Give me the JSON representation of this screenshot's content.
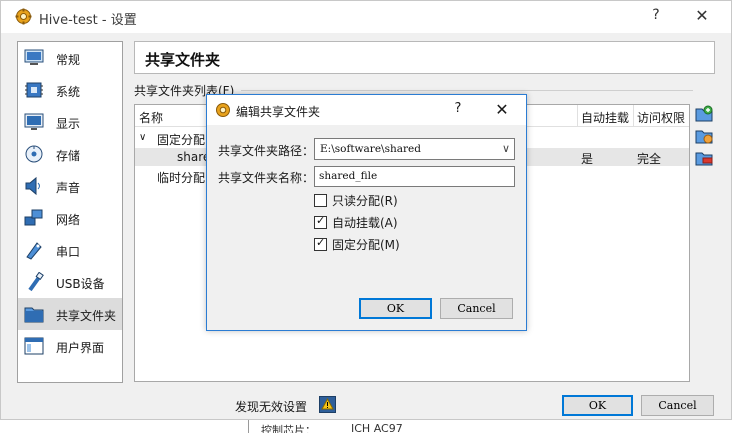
{
  "window": {
    "title": "Hive-test - 设置",
    "help": "?",
    "close": "✕"
  },
  "sidebar": {
    "items": [
      {
        "label": "常规",
        "icon": "monitor-icon"
      },
      {
        "label": "系统",
        "icon": "chip-icon"
      },
      {
        "label": "显示",
        "icon": "display-icon"
      },
      {
        "label": "存储",
        "icon": "storage-icon"
      },
      {
        "label": "声音",
        "icon": "speaker-icon"
      },
      {
        "label": "网络",
        "icon": "network-icon"
      },
      {
        "label": "串口",
        "icon": "serial-port-icon"
      },
      {
        "label": "USB设备",
        "icon": "usb-icon"
      },
      {
        "label": "共享文件夹",
        "icon": "folder-icon"
      },
      {
        "label": "用户界面",
        "icon": "ui-window-icon"
      }
    ],
    "active_index": 8
  },
  "page": {
    "title": "共享文件夹",
    "list_label": "共享文件夹列表(F)",
    "columns": {
      "name": "名称",
      "automount": "自动挂载",
      "access": "访问权限"
    },
    "tree": {
      "machine_folders": "固定分配",
      "shared_row": {
        "name": "share",
        "automount": "是",
        "access": "完全"
      },
      "transient_folders": "临时分配"
    }
  },
  "footer": {
    "status": "发现无效设置",
    "ok": "OK",
    "cancel": "Cancel"
  },
  "background": {
    "label": "控制芯片：",
    "value": "ICH AC97"
  },
  "dialog": {
    "title": "编辑共享文件夹",
    "help": "?",
    "close": "✕",
    "path_label": "共享文件夹路径：",
    "path_value": "E:\\software\\shared",
    "name_label": "共享文件夹名称：",
    "name_value": "shared_file",
    "readonly_label": "只读分配(R)",
    "readonly_checked": false,
    "automount_label": "自动挂载(A)",
    "automount_checked": true,
    "permanent_label": "固定分配(M)",
    "permanent_checked": true,
    "ok": "OK",
    "cancel": "Cancel"
  },
  "colors": {
    "accent": "#0078d7",
    "selection": "#dcdcdc",
    "window_bg": "#f0f0f0"
  }
}
